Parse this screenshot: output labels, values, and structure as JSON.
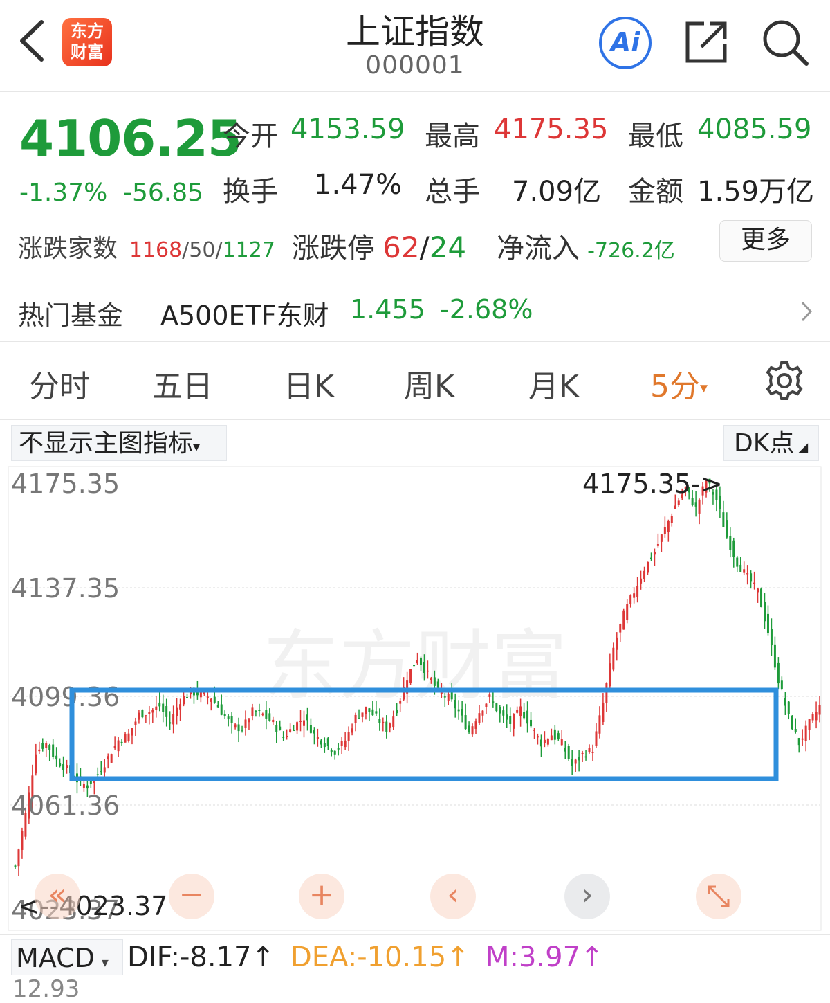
{
  "header": {
    "logo_line1": "东方",
    "logo_line2": "财富",
    "title": "上证指数",
    "code": "000001",
    "ai_label": "Ai"
  },
  "quote": {
    "price": "4106.25",
    "change_pct": "-1.37%",
    "change_abs": "-56.85",
    "open_label": "今开",
    "open_value": "4153.59",
    "high_label": "最高",
    "high_value": "4175.35",
    "low_label": "最低",
    "low_value": "4085.59",
    "turnover_label": "换手",
    "turnover_value": "1.47%",
    "volume_label": "总手",
    "volume_value": "7.09亿",
    "amount_label": "金额",
    "amount_value": "1.59万亿",
    "breadth_label": "涨跌家数",
    "breadth_up": "1168",
    "breadth_flat": "50",
    "breadth_down": "1127",
    "breadth_sep": "/",
    "limit_label": "涨跌停",
    "limit_up": "62",
    "limit_down": "24",
    "netflow_label": "净流入",
    "netflow_value": "-726.2亿",
    "more_label": "更多"
  },
  "fund": {
    "label": "热门基金",
    "name": "A500ETF东财",
    "price": "1.455",
    "change": "-2.68%"
  },
  "tabs": [
    "分时",
    "五日",
    "日K",
    "周K",
    "月K",
    "5分"
  ],
  "chart": {
    "indicator_label": "不显示主图指标",
    "dk_label": "DK点",
    "y_labels": [
      "4175.35",
      "4137.35",
      "4099.36",
      "4061.36",
      "4023.37"
    ],
    "max_marker": "4175.35->",
    "min_marker": "<--4023.37",
    "watermark": "东方财富",
    "colors": {
      "up": "#dd3737",
      "down": "#1e9b3a",
      "box": "#2f8fdc"
    }
  },
  "chart_data": {
    "type": "candlestick",
    "interval": "5分",
    "ylim": [
      4023.37,
      4175.35
    ],
    "y_ticks": [
      4175.35,
      4137.35,
      4099.36,
      4061.36,
      4023.37
    ],
    "max_label": 4175.35,
    "min_label": 4023.37,
    "close_path_approx": [
      4040,
      4058,
      4080,
      4083,
      4077,
      4074,
      4070,
      4068,
      4072,
      4078,
      4084,
      4086,
      4093,
      4094,
      4096,
      4090,
      4098,
      4101,
      4100,
      4099,
      4094,
      4089,
      4088,
      4094,
      4093,
      4090,
      4085,
      4089,
      4092,
      4086,
      4083,
      4080,
      4084,
      4092,
      4095,
      4092,
      4088,
      4095,
      4106,
      4113,
      4107,
      4101,
      4099,
      4094,
      4087,
      4094,
      4099,
      4093,
      4090,
      4095,
      4089,
      4083,
      4086,
      4083,
      4075,
      4079,
      4081,
      4097,
      4116,
      4128,
      4136,
      4144,
      4150,
      4158,
      4166,
      4172,
      4165,
      4175,
      4168,
      4155,
      4146,
      4141,
      4136,
      4122,
      4105,
      4092,
      4083,
      4090,
      4096
    ]
  },
  "macd": {
    "label": "MACD",
    "dif": "DIF:-8.17",
    "dea": "DEA:-10.15",
    "m": "M:3.97",
    "arrow": "↑",
    "partial_axis": "12.93",
    "colors": {
      "dif": "#222222",
      "dea": "#f0a030",
      "m": "#c040c8"
    }
  }
}
